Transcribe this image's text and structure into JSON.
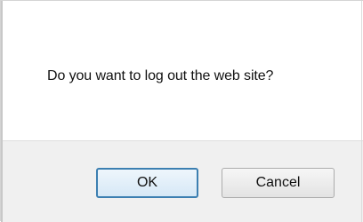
{
  "dialog": {
    "message": "Do you want to log out the web site?",
    "ok_label": "OK",
    "cancel_label": "Cancel"
  }
}
